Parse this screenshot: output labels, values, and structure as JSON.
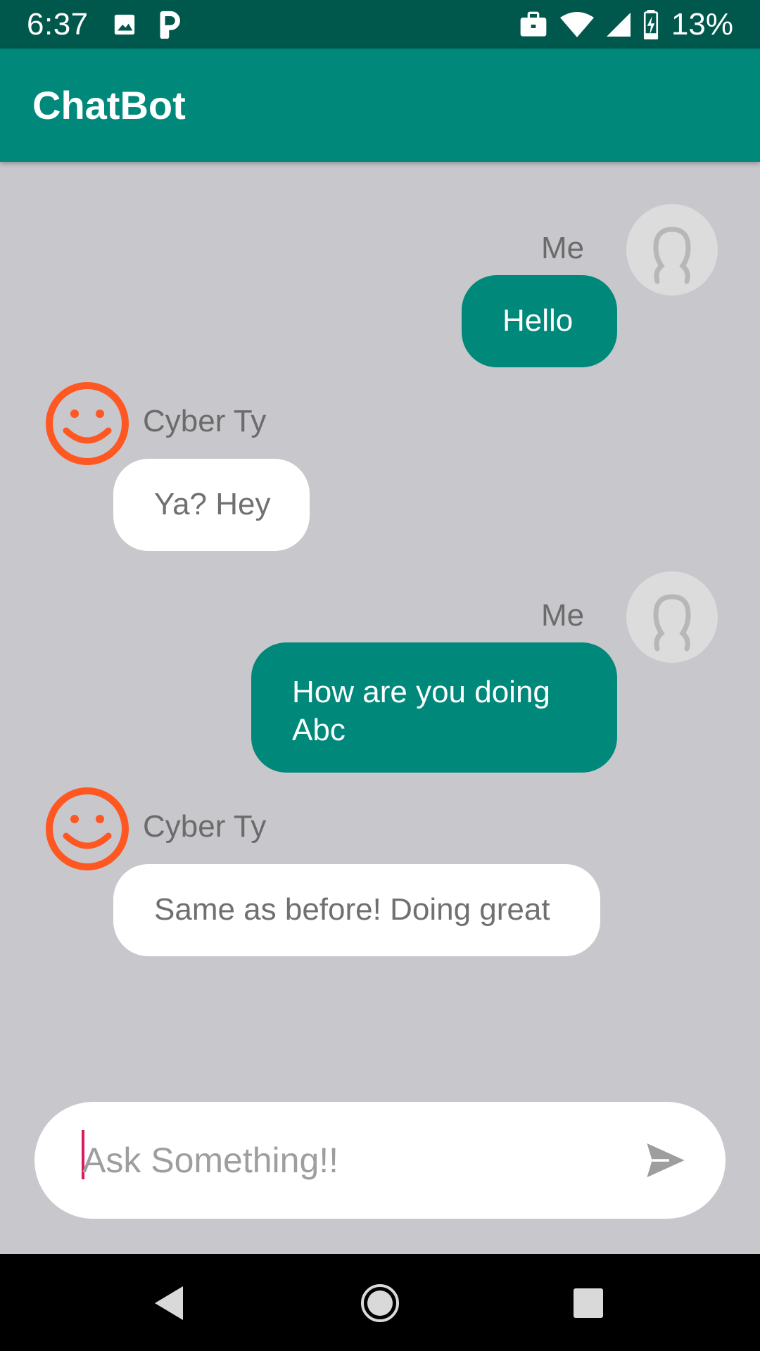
{
  "status_bar": {
    "time": "6:37",
    "battery_percent": "13%",
    "icons": [
      "image-icon",
      "parking-icon",
      "briefcase-icon",
      "wifi-icon",
      "signal-icon",
      "battery-charging-icon"
    ]
  },
  "app_bar": {
    "title": "ChatBot"
  },
  "messages": [
    {
      "sender": "Me",
      "text": "Hello",
      "from_user": true
    },
    {
      "sender": "Cyber Ty",
      "text": "Ya? Hey",
      "from_user": false
    },
    {
      "sender": "Me",
      "text": "How are you doing Abc",
      "from_user": true
    },
    {
      "sender": "Cyber Ty",
      "text": "Same as before! Doing great",
      "from_user": false
    }
  ],
  "input": {
    "placeholder": "Ask Something!!",
    "value": ""
  },
  "colors": {
    "accent": "#00897b",
    "status_bar": "#00574b",
    "background": "#c8c7cc",
    "bot_avatar": "#ff5722",
    "cursor": "#d81b60"
  },
  "nav_bar": {
    "buttons": [
      "back-icon",
      "home-icon",
      "recents-icon"
    ]
  }
}
